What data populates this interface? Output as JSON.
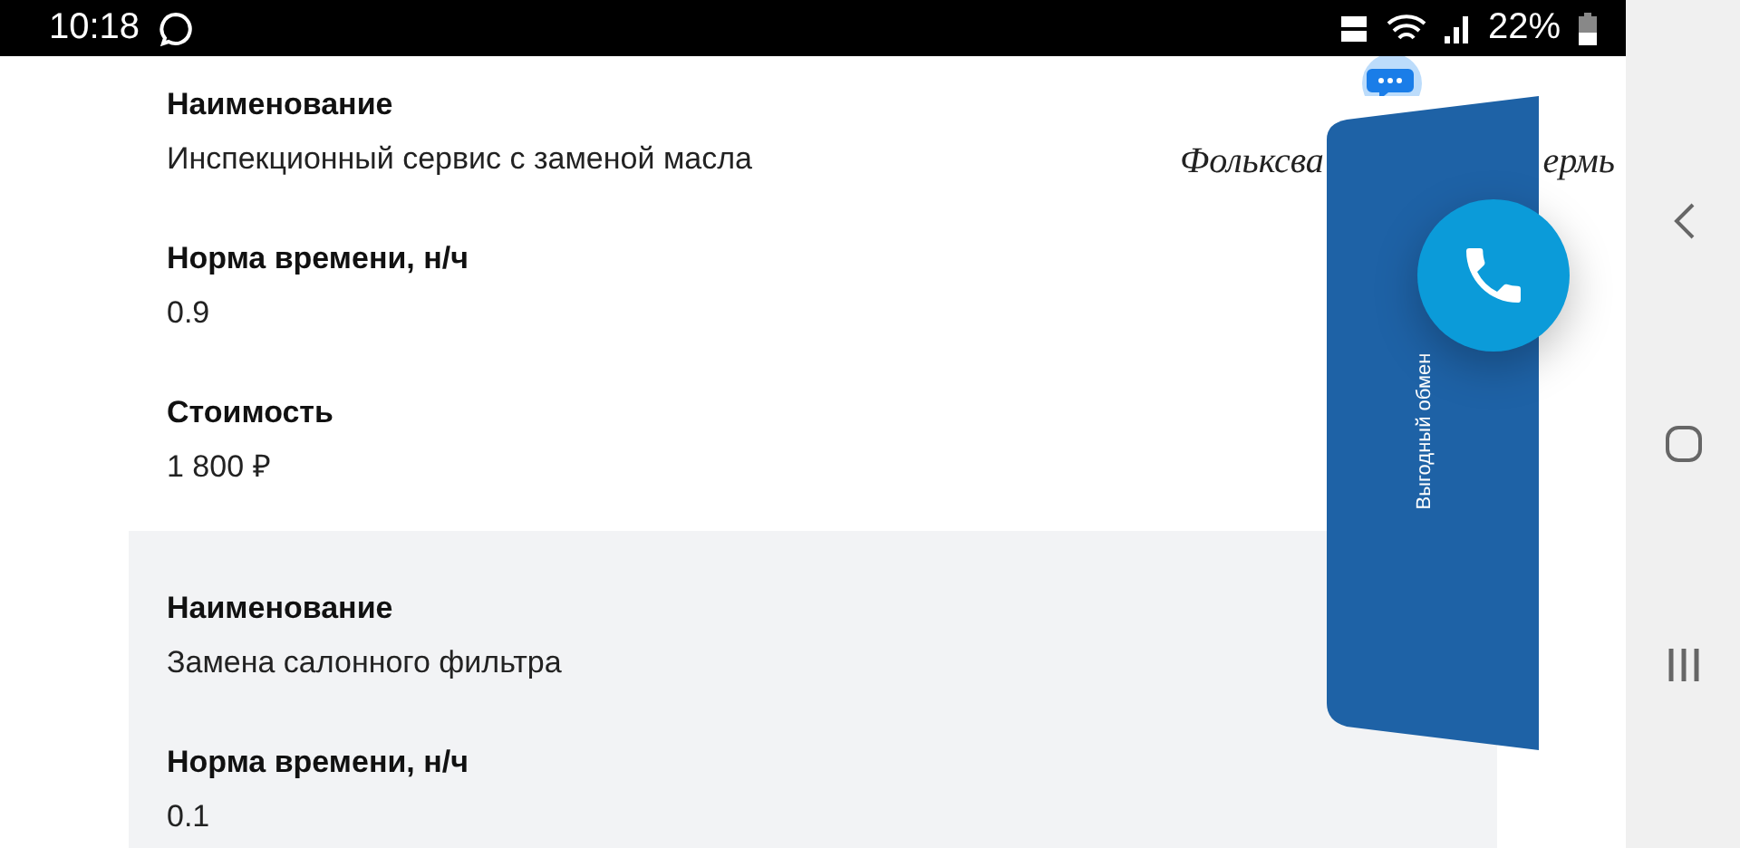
{
  "status_bar": {
    "time": "10:18",
    "battery": "22%"
  },
  "sections": [
    {
      "shaded": false,
      "fields": [
        {
          "label": "Наименование",
          "value": "Инспекционный сервис с заменой масла"
        },
        {
          "label": "Норма времени, н/ч",
          "value": "0.9"
        },
        {
          "label": "Стоимость",
          "value": "1 800 ₽"
        }
      ]
    },
    {
      "shaded": true,
      "fields": [
        {
          "label": "Наименование",
          "value": "Замена салонного фильтра"
        },
        {
          "label": "Норма времени, н/ч",
          "value": "0.1"
        }
      ]
    }
  ],
  "logo": {
    "parts": [
      "Фольксва",
      "ермь"
    ]
  },
  "promo_tab": {
    "label": "Выгодный обмен"
  }
}
